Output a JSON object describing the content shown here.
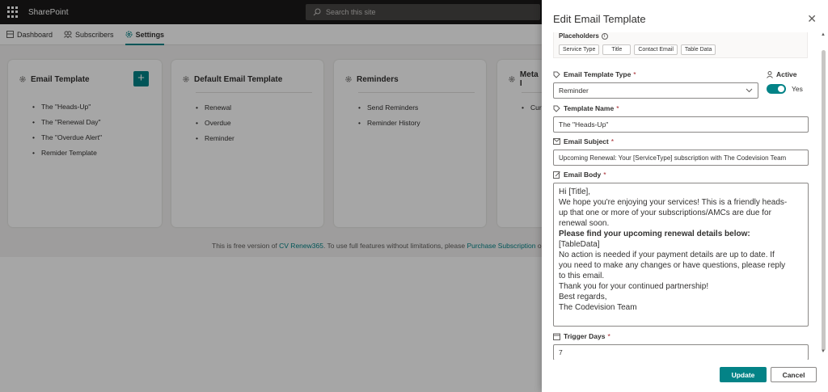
{
  "app": {
    "name": "SharePoint"
  },
  "search": {
    "placeholder": "Search this site"
  },
  "nav": [
    {
      "label": "Dashboard"
    },
    {
      "label": "Subscribers"
    },
    {
      "label": "Settings"
    }
  ],
  "cards": [
    {
      "title": "Email Template",
      "items": [
        "The \"Heads-Up\"",
        "The \"Renewal Day\"",
        "The \"Overdue Alert\"",
        "Remider Template"
      ]
    },
    {
      "title": "Default Email Template",
      "items": [
        "Renewal",
        "Overdue",
        "Reminder"
      ]
    },
    {
      "title": "Reminders",
      "items": [
        "Send Reminders",
        "Reminder History"
      ]
    },
    {
      "title": "Meta I",
      "items": [
        "Curren"
      ]
    }
  ],
  "footer": {
    "prefix": "This is free version of ",
    "link1": "CV Renew365",
    "middle": ". To use full features without limitations, please ",
    "link2": "Purchase Subscription",
    "suffix": " or e"
  },
  "panel": {
    "title": "Edit Email Template",
    "placeholders_label": "Placeholders",
    "placeholders": [
      "Service Type",
      "Title",
      "Contact Email",
      "Table Data"
    ],
    "type_label": "Email Template Type",
    "type_value": "Reminder",
    "active_label": "Active",
    "active_value": "Yes",
    "name_label": "Template Name",
    "name_value": "The \"Heads-Up\"",
    "subject_label": "Email Subject",
    "subject_value": "Upcoming Renewal: Your [ServiceType] subscription with The Codevision Team",
    "body_label": "Email Body",
    "body_lines": [
      "Hi [Title],",
      "We hope you're enjoying your services! This is a friendly heads-",
      "up that one or more of your subscriptions/AMCs are due for",
      "renewal soon.",
      "Please find your upcoming renewal details below:",
      "[TableData]",
      "No action is needed if your payment details are up to date. If",
      "you need to make any changes or have questions, please reply",
      "to this email.",
      "Thank you for your continued partnership!",
      "Best regards,",
      "The Codevision Team"
    ],
    "trigger_label": "Trigger Days",
    "trigger_value": "7",
    "update_label": "Update",
    "cancel_label": "Cancel",
    "required_mark": "*"
  },
  "colors": {
    "accent": "#038387",
    "topbar": "#1b1a19"
  }
}
